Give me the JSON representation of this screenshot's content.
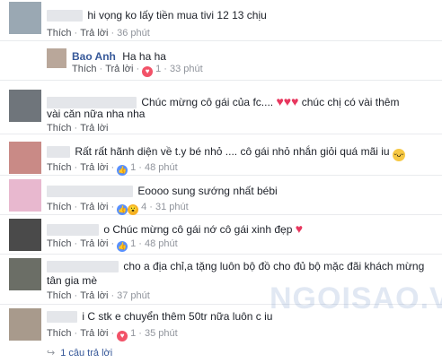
{
  "colors": {
    "link": "#365899",
    "meta": "#90949c",
    "like": "#5890ff",
    "love": "#f25268"
  },
  "comments": [
    {
      "text": "hi vọng ko lấy tiền mua tivi 12 13 chịu",
      "like": "Thích",
      "reply": "Trả lời",
      "time": "36 phút"
    },
    {
      "name": "Bao Anh",
      "text": "Ha ha ha",
      "like": "Thích",
      "reply": "Trả lời",
      "count": "1",
      "time": "33 phút"
    },
    {
      "text": "Chúc mừng cô gái của fc....",
      "text2": "chúc chị có vài thêm",
      "text3": "vài căn nữa nha nha",
      "like": "Thích",
      "reply": "Trả lời"
    },
    {
      "text": "Rất rất hãnh diện về t.y bé nhỏ .... cô gái nhỏ nhắn giỏi quá mãi iu",
      "like": "Thích",
      "reply": "Trả lời",
      "count": "1",
      "time": "48 phút"
    },
    {
      "text": "Eoooo sung sướng nhất bébi",
      "like": "Thích",
      "reply": "Trả lời",
      "count": "4",
      "time": "31 phút"
    },
    {
      "text": "o Chúc mừng cô gái nớ cô gái xinh đẹp",
      "like": "Thích",
      "reply": "Trả lời",
      "count": "1",
      "time": "48 phút"
    },
    {
      "text": "cho a địa chỉ,a tặng luôn bộ đồ cho đủ bộ mặc đãi khách mừng",
      "text2": "tân gia mè",
      "like": "Thích",
      "reply": "Trả lời",
      "time": "37 phút"
    },
    {
      "text": "i C stk e chuyển thêm 50tr nữa luôn c iu",
      "like": "Thích",
      "reply": "Trả lời",
      "count": "1",
      "time": "35 phút"
    }
  ],
  "footer": {
    "replies": "1 câu trả lời"
  },
  "watermark": "NGOISAO.VN"
}
